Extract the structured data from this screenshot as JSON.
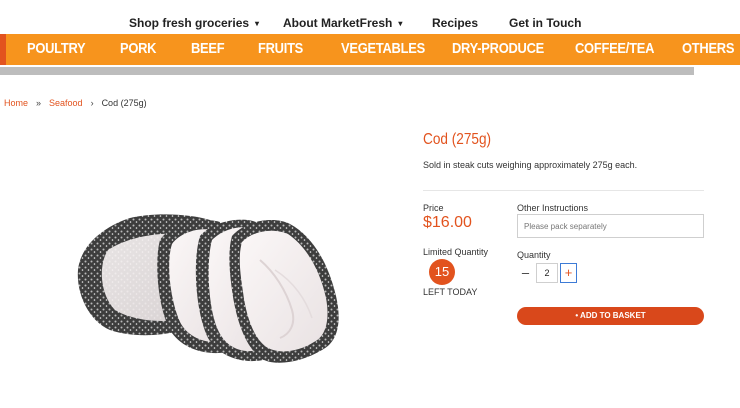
{
  "topnav": {
    "items": [
      {
        "label": "Shop fresh groceries",
        "dropdown": true
      },
      {
        "label": "About MarketFresh",
        "dropdown": true
      },
      {
        "label": "Recipes",
        "dropdown": false
      },
      {
        "label": "Get in Touch",
        "dropdown": false
      }
    ],
    "caret": "▾"
  },
  "categories": [
    "POULTRY",
    "PORK",
    "BEEF",
    "FRUITS",
    "VEGETABLES",
    "DRY-PRODUCE",
    "COFFEE/TEA",
    "OTHERS"
  ],
  "breadcrumb": {
    "home": "Home",
    "sep1": "»",
    "section": "Seafood",
    "sep2": "›",
    "current": "Cod (275g)"
  },
  "product": {
    "title": "Cod (275g)",
    "description": "Sold in steak cuts weighing approximately 275g each.",
    "price_label": "Price",
    "price": "$16.00",
    "instructions_label": "Other Instructions",
    "instructions_placeholder": "Please pack separately",
    "instructions_value": "",
    "limited_label": "Limited Quantity",
    "limited_count": "15",
    "left_today": "LEFT TODAY",
    "quantity_label": "Quantity",
    "quantity": "2",
    "minus": "–",
    "plus": "+",
    "add_to_basket": "• ADD TO BASKET"
  },
  "colors": {
    "accent": "#e2531e",
    "category_bar": "#f7941d",
    "divider_gray": "#bdbdbd",
    "add_button": "#d9481b"
  },
  "icons": {
    "dropdown": "chevron-down-icon",
    "product_image": "cod-steaks-image"
  }
}
